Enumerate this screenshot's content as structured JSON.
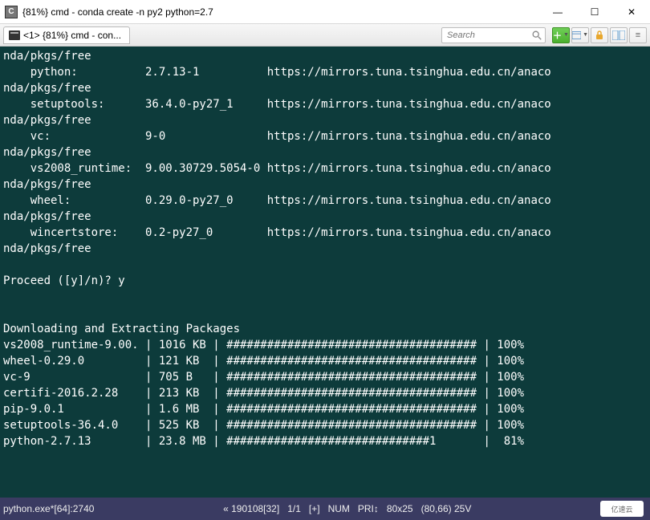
{
  "window": {
    "title": "{81%} cmd - conda  create -n py2 python=2.7",
    "icon_letter": "C"
  },
  "tab": {
    "label": "<1> {81%} cmd - con..."
  },
  "search": {
    "placeholder": "Search"
  },
  "terminal": {
    "packages": [
      {
        "path": "nda/pkgs/free",
        "name": "python:",
        "version": "2.7.13-1",
        "url": "https://mirrors.tuna.tsinghua.edu.cn/anaco"
      },
      {
        "path": "nda/pkgs/free",
        "name": "setuptools:",
        "version": "36.4.0-py27_1",
        "url": "https://mirrors.tuna.tsinghua.edu.cn/anaco"
      },
      {
        "path": "nda/pkgs/free",
        "name": "vc:",
        "version": "9-0",
        "url": "https://mirrors.tuna.tsinghua.edu.cn/anaco"
      },
      {
        "path": "nda/pkgs/free",
        "name": "vs2008_runtime:",
        "version": "9.00.30729.5054-0",
        "url": "https://mirrors.tuna.tsinghua.edu.cn/anaco"
      },
      {
        "path": "nda/pkgs/free",
        "name": "wheel:",
        "version": "0.29.0-py27_0",
        "url": "https://mirrors.tuna.tsinghua.edu.cn/anaco"
      },
      {
        "path": "nda/pkgs/free",
        "name": "wincertstore:",
        "version": "0.2-py27_0",
        "url": "https://mirrors.tuna.tsinghua.edu.cn/anaco"
      }
    ],
    "prompt": "Proceed ([y]/n)? y",
    "dl_header": "Downloading and Extracting Packages",
    "downloads": [
      {
        "pkg": "vs2008_runtime-9.00.",
        "size": "1016 KB",
        "bar": "##################################### | 100%"
      },
      {
        "pkg": "wheel-0.29.0",
        "size": "121 KB",
        "bar": "##################################### | 100%"
      },
      {
        "pkg": "vc-9",
        "size": "705 B",
        "bar": "##################################### | 100%"
      },
      {
        "pkg": "certifi-2016.2.28",
        "size": "213 KB",
        "bar": "##################################### | 100%"
      },
      {
        "pkg": "pip-9.0.1",
        "size": "1.6 MB",
        "bar": "##################################### | 100%"
      },
      {
        "pkg": "setuptools-36.4.0",
        "size": "525 KB",
        "bar": "##################################### | 100%"
      },
      {
        "pkg": "python-2.7.13",
        "size": "23.8 MB",
        "bar": "##############################1       |  81%"
      }
    ]
  },
  "status": {
    "left": "python.exe*[64]:2740",
    "encoding": "« 190108[32]",
    "pos": "1/1",
    "plus": "[+]",
    "num": "NUM",
    "pri": "PRI↕",
    "size": "80x25",
    "cursor": "(80,66) 25V",
    "logo": "亿速云"
  }
}
